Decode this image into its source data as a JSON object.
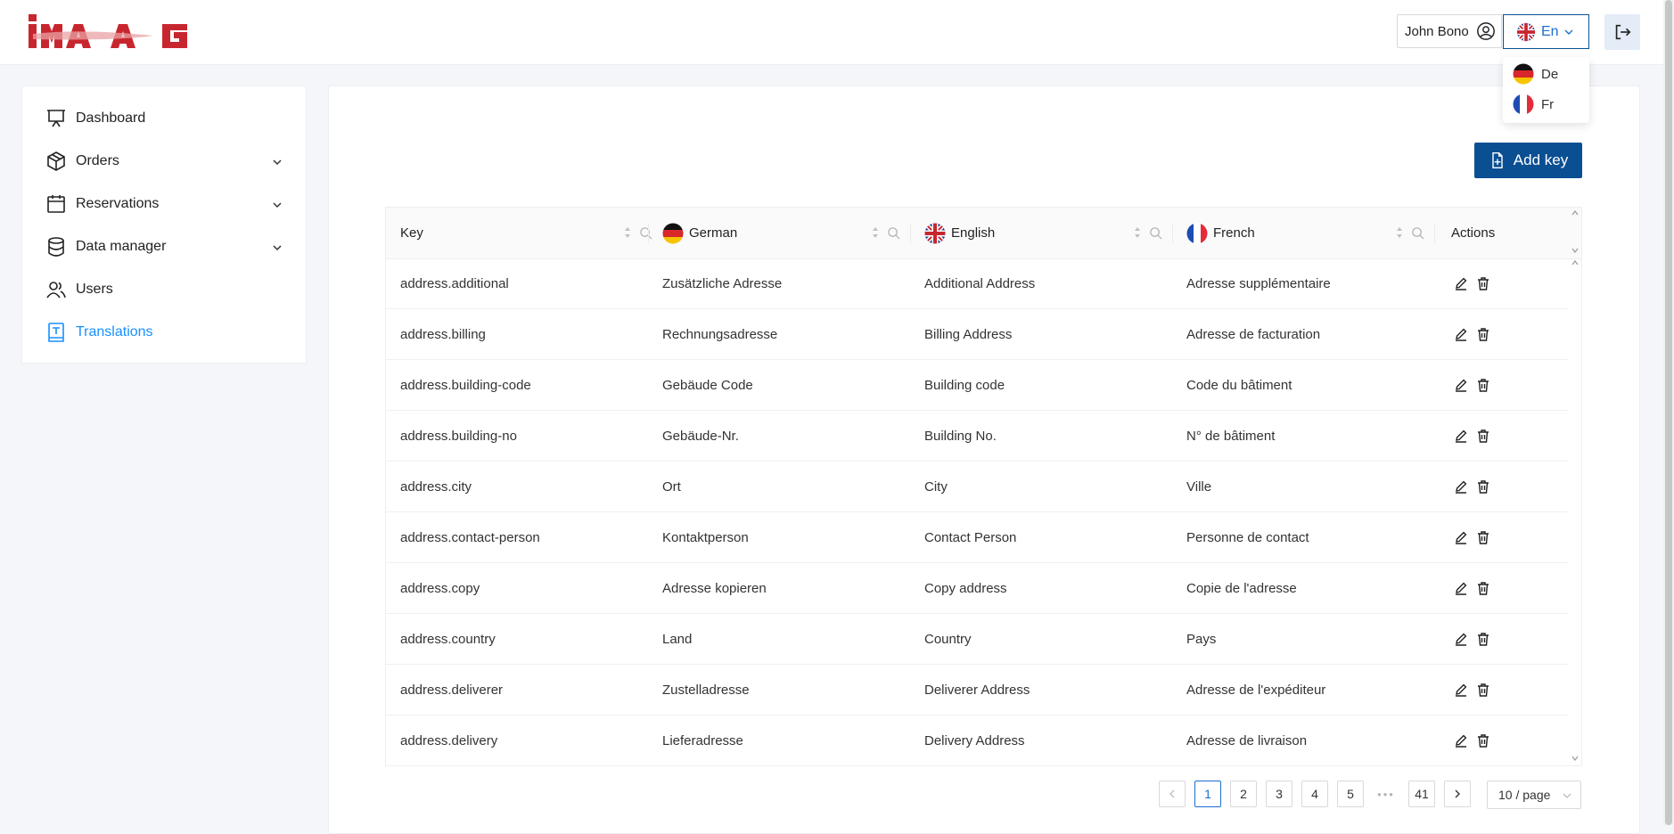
{
  "app": {
    "logo_text": "ima AG",
    "user_name": "John Bono",
    "current_lang": "En",
    "lang_options": [
      {
        "code": "de",
        "label": "De"
      },
      {
        "code": "fr",
        "label": "Fr"
      }
    ],
    "colors": {
      "primary": "#0b4f93",
      "accent": "#1890ff",
      "logo": "#c8262e"
    }
  },
  "sidebar": {
    "items": [
      {
        "label": "Dashboard",
        "icon": "presentation-icon",
        "expandable": false,
        "active": false
      },
      {
        "label": "Orders",
        "icon": "package-icon",
        "expandable": true,
        "active": false
      },
      {
        "label": "Reservations",
        "icon": "calendar-icon",
        "expandable": true,
        "active": false
      },
      {
        "label": "Data manager",
        "icon": "database-icon",
        "expandable": true,
        "active": false
      },
      {
        "label": "Users",
        "icon": "users-icon",
        "expandable": false,
        "active": false
      },
      {
        "label": "Translations",
        "icon": "translate-icon",
        "expandable": false,
        "active": true
      }
    ]
  },
  "toolbar": {
    "add_key_label": "Add key"
  },
  "table": {
    "columns": [
      {
        "label": "Key",
        "flag": null
      },
      {
        "label": "German",
        "flag": "de"
      },
      {
        "label": "English",
        "flag": "en"
      },
      {
        "label": "French",
        "flag": "fr"
      },
      {
        "label": "Actions",
        "flag": null
      }
    ],
    "rows": [
      {
        "key": "address.additional",
        "de": "Zusätzliche Adresse",
        "en": "Additional Address",
        "fr": "Adresse supplémentaire"
      },
      {
        "key": "address.billing",
        "de": "Rechnungsadresse",
        "en": "Billing Address",
        "fr": "Adresse de facturation"
      },
      {
        "key": "address.building-code",
        "de": "Gebäude Code",
        "en": "Building code",
        "fr": "Code du bâtiment"
      },
      {
        "key": "address.building-no",
        "de": "Gebäude-Nr.",
        "en": "Building No.",
        "fr": "N° de bâtiment"
      },
      {
        "key": "address.city",
        "de": "Ort",
        "en": "City",
        "fr": "Ville"
      },
      {
        "key": "address.contact-person",
        "de": "Kontaktperson",
        "en": "Contact Person",
        "fr": "Personne de contact"
      },
      {
        "key": "address.copy",
        "de": "Adresse kopieren",
        "en": "Copy address",
        "fr": "Copie de l'adresse"
      },
      {
        "key": "address.country",
        "de": "Land",
        "en": "Country",
        "fr": "Pays"
      },
      {
        "key": "address.deliverer",
        "de": "Zustelladresse",
        "en": "Deliverer Address",
        "fr": "Adresse de l'expéditeur"
      },
      {
        "key": "address.delivery",
        "de": "Lieferadresse",
        "en": "Delivery Address",
        "fr": "Adresse de livraison"
      }
    ]
  },
  "pagination": {
    "pages": [
      "1",
      "2",
      "3",
      "4",
      "5"
    ],
    "current": "1",
    "ellipsis": "•••",
    "last": "41",
    "page_size": "10 / page"
  }
}
